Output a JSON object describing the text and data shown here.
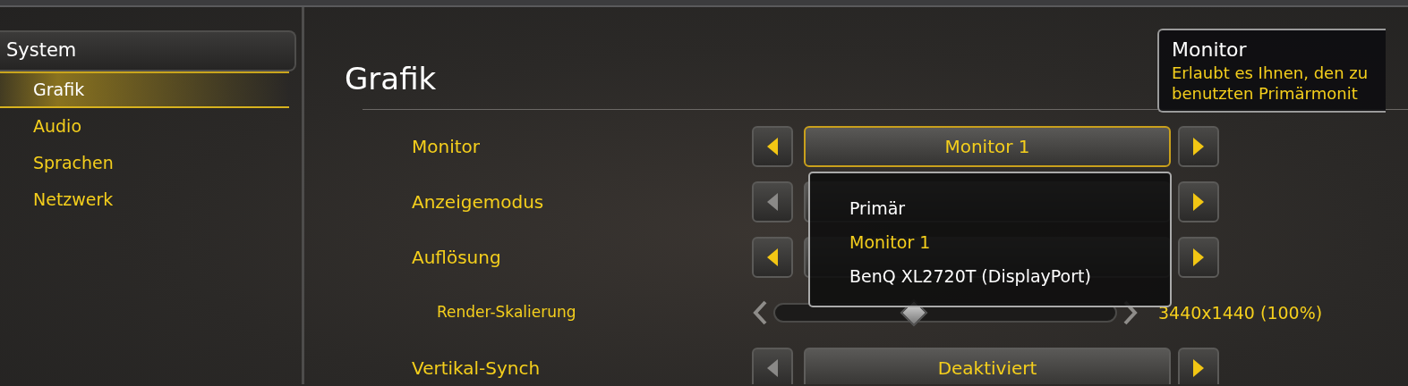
{
  "sidebar": {
    "section": "System",
    "items": [
      {
        "label": "Grafik",
        "selected": true
      },
      {
        "label": "Audio",
        "selected": false
      },
      {
        "label": "Sprachen",
        "selected": false
      },
      {
        "label": "Netzwerk",
        "selected": false
      }
    ]
  },
  "title": "Grafik",
  "settings": [
    {
      "kind": "select",
      "label": "Monitor",
      "value": "Monitor 1",
      "left_enabled": true,
      "right_enabled": true,
      "focused": true
    },
    {
      "kind": "select",
      "label": "Anzeigemodus",
      "left_enabled": false,
      "right_enabled": true,
      "focused": false
    },
    {
      "kind": "select",
      "label": "Auflösung",
      "left_enabled": true,
      "right_enabled": true,
      "focused": false
    },
    {
      "kind": "slider",
      "label": "Render-Skalierung",
      "level": 0.41,
      "reading": "3440x1440 (100%)"
    },
    {
      "kind": "select",
      "label": "Vertikal-Synch",
      "value": "Deaktiviert",
      "left_enabled": false,
      "right_enabled": true,
      "focused": false
    }
  ],
  "dropdown": {
    "options": [
      {
        "label": "Primär",
        "selected": false
      },
      {
        "label": "Monitor 1",
        "selected": true
      },
      {
        "label": "BenQ XL2720T (DisplayPort)",
        "selected": false
      }
    ]
  },
  "tooltip": {
    "title": "Monitor",
    "lines": [
      "Erlaubt es Ihnen, den zu",
      "benutzten Primärmonit"
    ]
  }
}
